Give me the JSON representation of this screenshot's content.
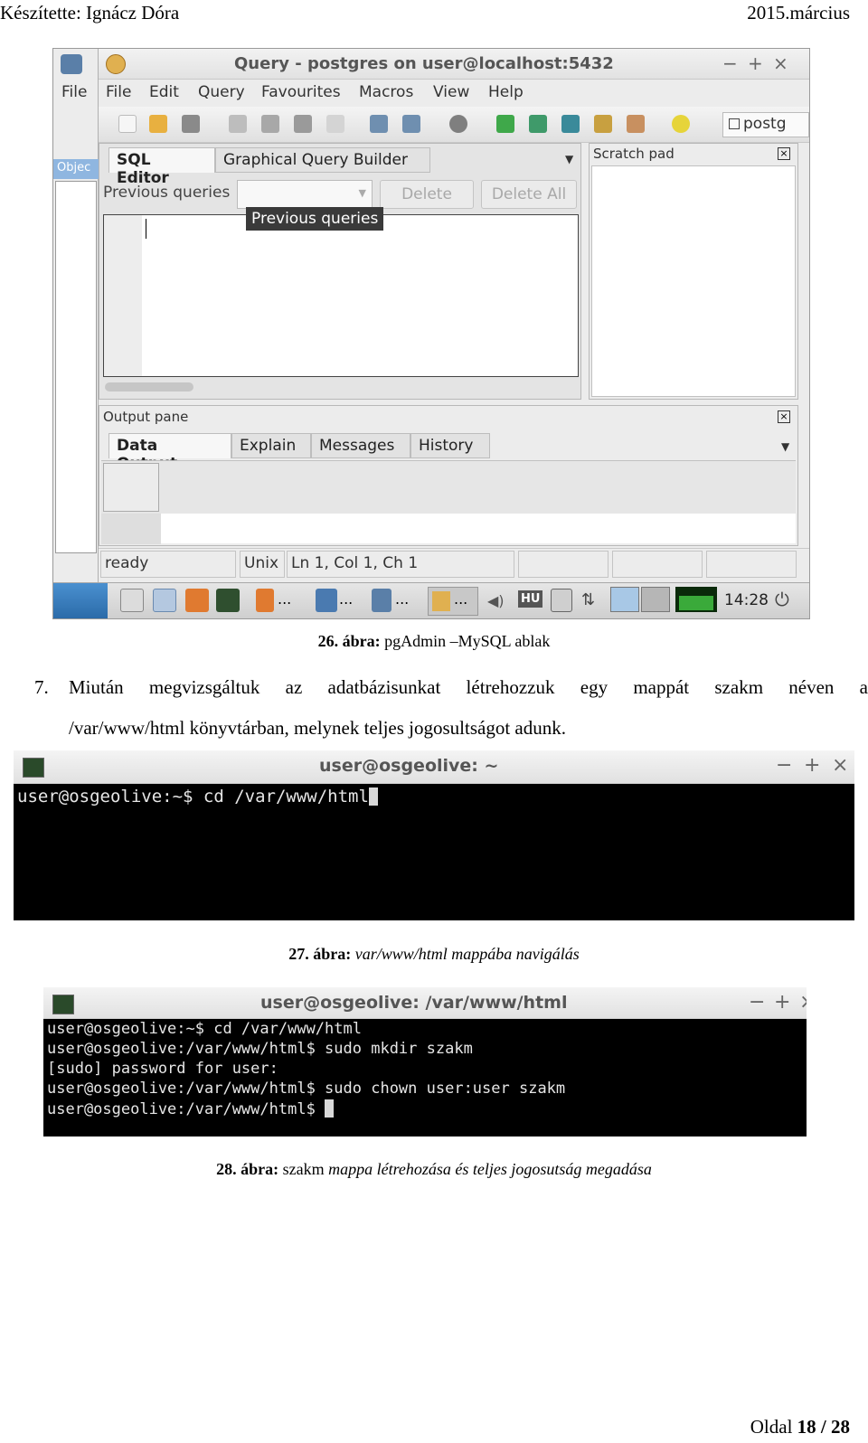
{
  "header": {
    "author": "Készítette: Ignácz Dóra",
    "date": "2015.március"
  },
  "pgadmin": {
    "side_menu": "File",
    "side_label": "Objec",
    "title": "Query - postgres on user@localhost:5432",
    "win_controls": [
      "−",
      "+",
      "×"
    ],
    "menu": [
      "File",
      "Edit",
      "Query",
      "Favourites",
      "Macros",
      "View",
      "Help"
    ],
    "server_combo": "postg",
    "editor_tabs": [
      "SQL Editor",
      "Graphical Query Builder"
    ],
    "previous_queries_label": "Previous queries",
    "tooltip": "Previous queries",
    "delete_button": "Delete",
    "delete_all_button": "Delete All",
    "scratch_pad": "Scratch pad",
    "output_pane": "Output pane",
    "output_tabs": [
      "Data Output",
      "Explain",
      "Messages",
      "History"
    ],
    "status": {
      "state": "ready",
      "eol": "Unix",
      "position": "Ln 1, Col 1, Ch 1"
    },
    "taskbar": {
      "clock": "14:28",
      "ellipsis": "...",
      "kbd": "HU"
    }
  },
  "fig26": {
    "number": "26. ábra:",
    "text": "pgAdmin –MySQL ablak"
  },
  "step7": {
    "num": "7.",
    "line1": "Miután megvizsgáltuk az adatbázisunkat létrehozzuk egy mappát szakm néven a",
    "line2": "/var/www/html könyvtárban, melynek teljes jogosultságot adunk."
  },
  "term1": {
    "title": "user@osgeolive: ~",
    "lines": [
      "user@osgeolive:~$ cd /var/www/html"
    ]
  },
  "fig27": {
    "number": "27. ábra:",
    "text": "var/www/html mappába navigálás"
  },
  "term2": {
    "title": "user@osgeolive: /var/www/html",
    "lines": [
      "user@osgeolive:~$ cd /var/www/html",
      "user@osgeolive:/var/www/html$ sudo mkdir szakm",
      "[sudo] password for user:",
      "user@osgeolive:/var/www/html$ sudo chown user:user szakm",
      "user@osgeolive:/var/www/html$ "
    ]
  },
  "fig28": {
    "number": "28. ábra:",
    "word": "szakm",
    "text": "mappa létrehozása és teljes jogosutság megadása"
  },
  "footer": {
    "prefix": "Oldal ",
    "page": "18 / 28"
  }
}
